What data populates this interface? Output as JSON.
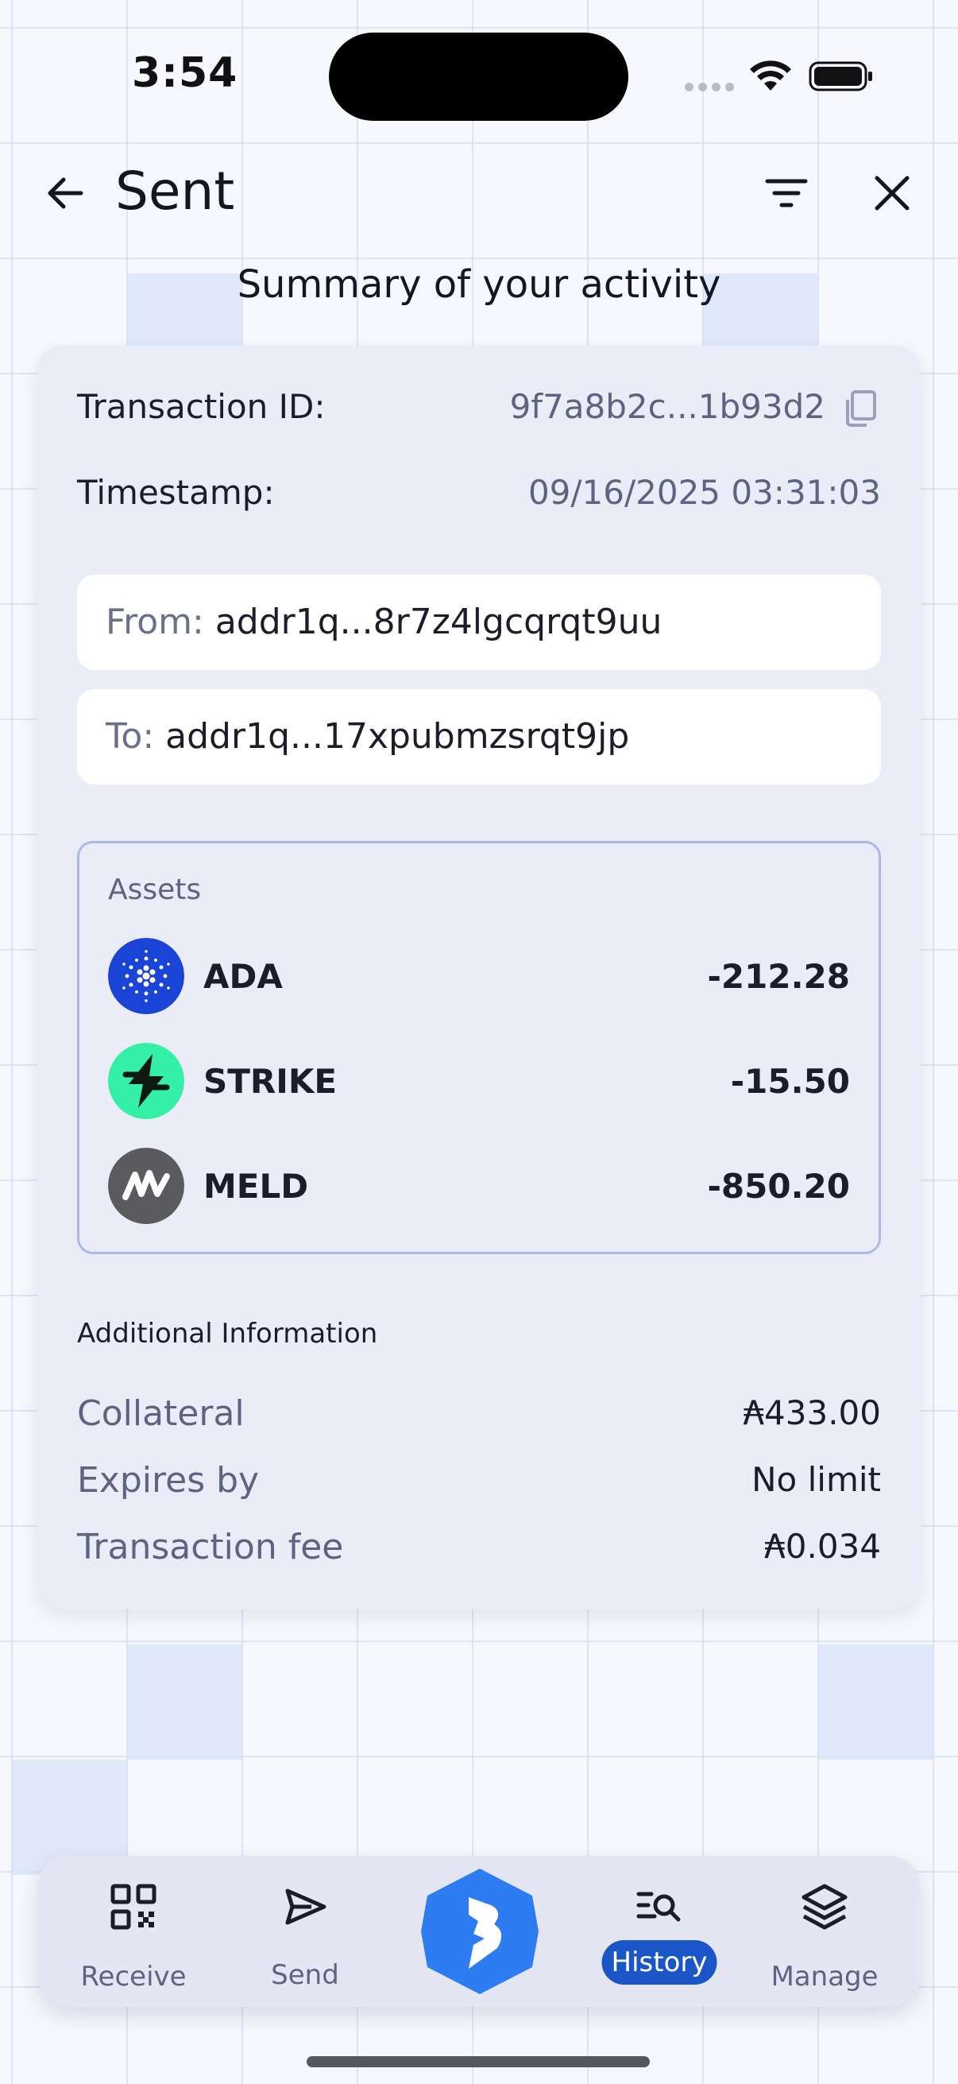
{
  "status_bar": {
    "time": "3:54"
  },
  "header": {
    "title": "Sent",
    "back_icon": "arrow-left-icon",
    "filter_icon": "filter-icon",
    "close_icon": "close-icon"
  },
  "subtitle": "Summary of your activity",
  "transaction": {
    "id_label": "Transaction ID:",
    "id_value": "9f7a8b2c...1b93d2",
    "timestamp_label": "Timestamp:",
    "timestamp_value": "09/16/2025 03:31:03",
    "from_label": "From:",
    "from_value": "addr1q...8r7z4lgcqrqt9uu",
    "to_label": "To:",
    "to_value": "addr1q...17xpubmzsrqt9jp"
  },
  "assets": {
    "title": "Assets",
    "items": [
      {
        "name": "ADA",
        "amount": "-212.28",
        "icon": "cardano-logo-icon",
        "color": "#1a44d6"
      },
      {
        "name": "STRIKE",
        "amount": "-15.50",
        "icon": "strike-logo-icon",
        "color": "#34f0a6"
      },
      {
        "name": "MELD",
        "amount": "-850.20",
        "icon": "meld-logo-icon",
        "color": "#5b5b5f"
      }
    ]
  },
  "additional": {
    "title": "Additional Information",
    "rows": [
      {
        "label": "Collateral",
        "value": "₳433.00"
      },
      {
        "label": "Expires by",
        "value": "No limit"
      },
      {
        "label": "Transaction fee",
        "value": "₳0.034"
      }
    ]
  },
  "nav": {
    "items": [
      {
        "label": "Receive",
        "icon": "qr-code-icon"
      },
      {
        "label": "Send",
        "icon": "send-icon"
      },
      {
        "label": "",
        "icon": "brand-logo-icon"
      },
      {
        "label": "History",
        "icon": "history-search-icon",
        "active": true
      },
      {
        "label": "Manage",
        "icon": "layers-icon"
      }
    ]
  },
  "colors": {
    "accent": "#1b56c9",
    "brand_hex": "#2e7cf2",
    "card_bg": "#eaecf7",
    "asset_border": "#a9b9e8"
  }
}
